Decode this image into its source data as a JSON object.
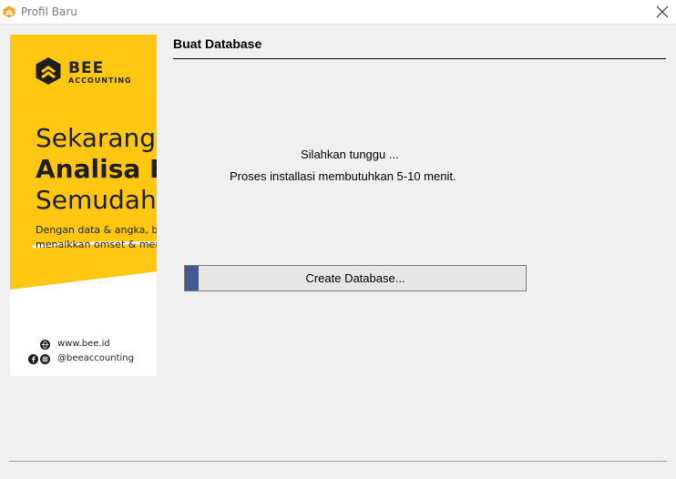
{
  "window": {
    "title": "Profil Baru",
    "close_icon": "close-icon"
  },
  "banner": {
    "brand_line1": "BEE",
    "brand_line2": "ACCOUNTING",
    "headline1": "Sekarang",
    "headline2": "Analisa B",
    "headline3": "Semudah",
    "desc_line1": "Dengan data & angka, bik",
    "desc_line2": "menaikkan omset & men",
    "website": "www.bee.id",
    "social_handle": "@beeaccounting",
    "accent_color": "#ffc612"
  },
  "page": {
    "heading": "Buat Database",
    "message1": "Silahkan tunggu ...",
    "message2": "Proses installasi membutuhkan 5-10 menit."
  },
  "progress": {
    "label": "Create Database...",
    "value_percent": 4,
    "fill_color": "#415a94"
  }
}
